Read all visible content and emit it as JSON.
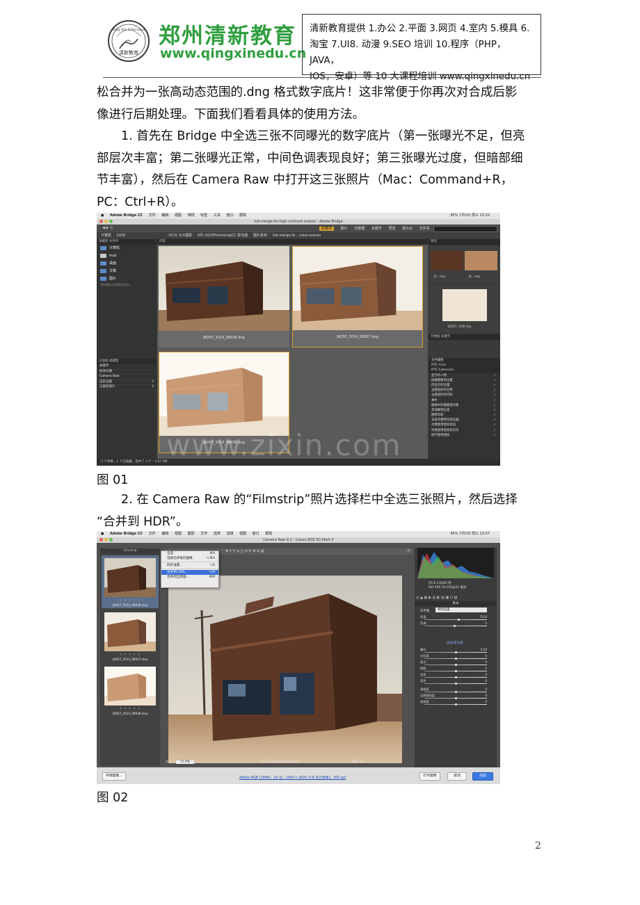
{
  "header": {
    "brand_name": "郑州清新教育",
    "brand_url": "www.qingxinedu.cn",
    "logo_text_top": "Qing Xin Education",
    "logo_text_center": "清新教育",
    "box_lines": [
      "清新教育提供 1.办公 2.平面 3.网页 4.室内 5.模具 6.",
      "淘宝 7.UI8. 动漫 9.SEO 培训 10.程序（PHP，JAVA，",
      "IOS，安卓）等 10 大课程培训 www.qingxinedu.cn"
    ]
  },
  "body": {
    "intro_lines": [
      "松合并为一张高动态范围的.dng 格式数字底片！这非常便于你再次对合成后影",
      "像进行后期处理。下面我们看看具体的使用方法。"
    ],
    "step1_lines": [
      "1. 首先在 Bridge 中全选三张不同曝光的数字底片（第一张曝光不足，但亮",
      "部层次丰富；第二张曝光正常，中间色调表现良好；第三张曝光过度，但暗部细",
      "节丰富），然后在 Camera Raw 中打开这三张照片（Mac：Command+R，",
      "PC：Ctrl+R）。"
    ],
    "fig1_label": "图 01",
    "step2_lines": [
      "2. 在 Camera Raw 的“Filmstrip”照片选择栏中全选三张照片，然后选择",
      "“合并到 HDR”。"
    ],
    "fig2_label": "图 02",
    "page_number": "2"
  },
  "bridge": {
    "menu": [
      "Adobe Bridge CC",
      "文件",
      "编辑",
      "视图",
      "堆栈",
      "标签",
      "工具",
      "窗口",
      "帮助"
    ],
    "menu_right": "95%  7月1日 周三  23:32",
    "window_title": "hdr-merge-for-high-contrast-scenes - Adobe Bridge",
    "tabs": [
      "必要项",
      "胶片",
      "元数据",
      "关键字",
      "预览",
      "看片台",
      "文件夹"
    ],
    "active_tab": "必要项",
    "path": [
      "计算机",
      "LiVQi",
      "2015 大众摄影",
      "8月 2015PhotoshopCC 影功能",
      "图片素材",
      "hdr-merge-fo....trast-scenes"
    ],
    "panel_tabs_left": "收藏夹   文件夹",
    "favorites": [
      "计算机",
      "livqi",
      "桌面",
      "文稿",
      "图片"
    ],
    "drag_hint": "将收藏夹内容拖放此处...",
    "filter_tabs": "过滤器   收藏集",
    "filters": [
      {
        "label": "关键字",
        "count": ""
      },
      {
        "label": "修改日期",
        "count": ""
      },
      {
        "label": "Camera Raw",
        "count": ""
      },
      {
        "label": "自定设置",
        "count": "3"
      },
      {
        "label": "已裁剪图片",
        "count": "3"
      }
    ],
    "content_tab": "内容",
    "thumbs": [
      {
        "caption": "JKOST_2014_08936.dng"
      },
      {
        "caption": "JKOST_2014_08937.dng"
      },
      {
        "caption": "JKOST_2014_08935.dng"
      }
    ],
    "right_tab": "预览",
    "preview_captions": [
      "JK...dng",
      "JK...dng",
      "JKOST...938.dng"
    ],
    "meta_tabs": "元数据   关键字",
    "meta_sections": [
      "文件属性",
      "IPTC Core",
      "IPTC Extension"
    ],
    "meta_rows": [
      "显示的人物",
      "拍摄图像的位置",
      "所显示的位置",
      "主题组织的名称",
      "主题组织的代码",
      "事件",
      "图像中的图稿或对象",
      "其他模特信息",
      "模特年龄",
      "未成年模特年龄证据",
      "肖像使用授权状态",
      "肖像使用授权标识符",
      "财产使用授权"
    ],
    "status": "3 个项目，1 个已隐藏，选中了 3 个 - 3.67 MB",
    "watermark": "www.zixin.com"
  },
  "cameraraw": {
    "menu": [
      "Adobe Bridge CC",
      "文件",
      "编辑",
      "视图",
      "图层",
      "文字",
      "选择",
      "滤镜",
      "视图",
      "窗口",
      "帮助"
    ],
    "menu_right": "95%  7月1日 周三  23:37",
    "window_title": "Camera Raw 9.1  -  Canon EOS 5D Mark II",
    "filmstrip_title": "Filmstrip",
    "film_items": [
      {
        "caption": "JKOST_2014_08936.dng",
        "stars": "• • • • •"
      },
      {
        "caption": "JKOST_2014_08937.dng",
        "stars": "• • • • •"
      },
      {
        "caption": "JKOST_2014_08938.dng",
        "stars": "• • • • •"
      }
    ],
    "context_menu": [
      {
        "label": "全选",
        "shortcut": "⌘A",
        "highlight": false
      },
      {
        "label": "选择已评级的图像",
        "shortcut": "⌥⌘A",
        "highlight": false
      },
      {
        "label": "同步设置...",
        "shortcut": "⌥S",
        "highlight": false
      },
      {
        "label": "合并到 HDR...",
        "shortcut": "⌥M",
        "highlight": true
      },
      {
        "label": "合并到全景图...",
        "shortcut": "⌘M",
        "highlight": false
      }
    ],
    "zoom": "71.9%",
    "image_name": "JKOST_2014_08936.dng",
    "image_counter": "图像 3/3",
    "camera_info": [
      "f/5.6  1/2000 秒",
      "ISO 400  24-105@32 毫米"
    ],
    "panel_title": "基本",
    "white_balance_label": "白平衡:",
    "white_balance_value": "原照设置",
    "sliders": [
      {
        "label": "色温",
        "value": "7210",
        "pos": 0.55
      },
      {
        "label": "色调",
        "value": "-3",
        "pos": 0.48
      },
      {
        "label": "曝光",
        "value": "0.00",
        "pos": 0.5
      },
      {
        "label": "对比度",
        "value": "0",
        "pos": 0.5
      },
      {
        "label": "高光",
        "value": "0",
        "pos": 0.5
      },
      {
        "label": "阴影",
        "value": "0",
        "pos": 0.5
      },
      {
        "label": "白色",
        "value": "0",
        "pos": 0.5
      },
      {
        "label": "黑色",
        "value": "0",
        "pos": 0.5
      },
      {
        "label": "清晰度",
        "value": "0",
        "pos": 0.5
      },
      {
        "label": "自然饱和度",
        "value": "0",
        "pos": 0.5
      },
      {
        "label": "饱和度",
        "value": "0",
        "pos": 0.5
      }
    ],
    "auto_links": "自动    默认值",
    "save_button": "存储图像...",
    "workflow_link": "Adobe RGB (1998)；16 位；2400 x 1600 (3.8 百万像素)；300 ppi",
    "open_button": "打开图像",
    "cancel_button": "取消",
    "done_button": "完成"
  }
}
